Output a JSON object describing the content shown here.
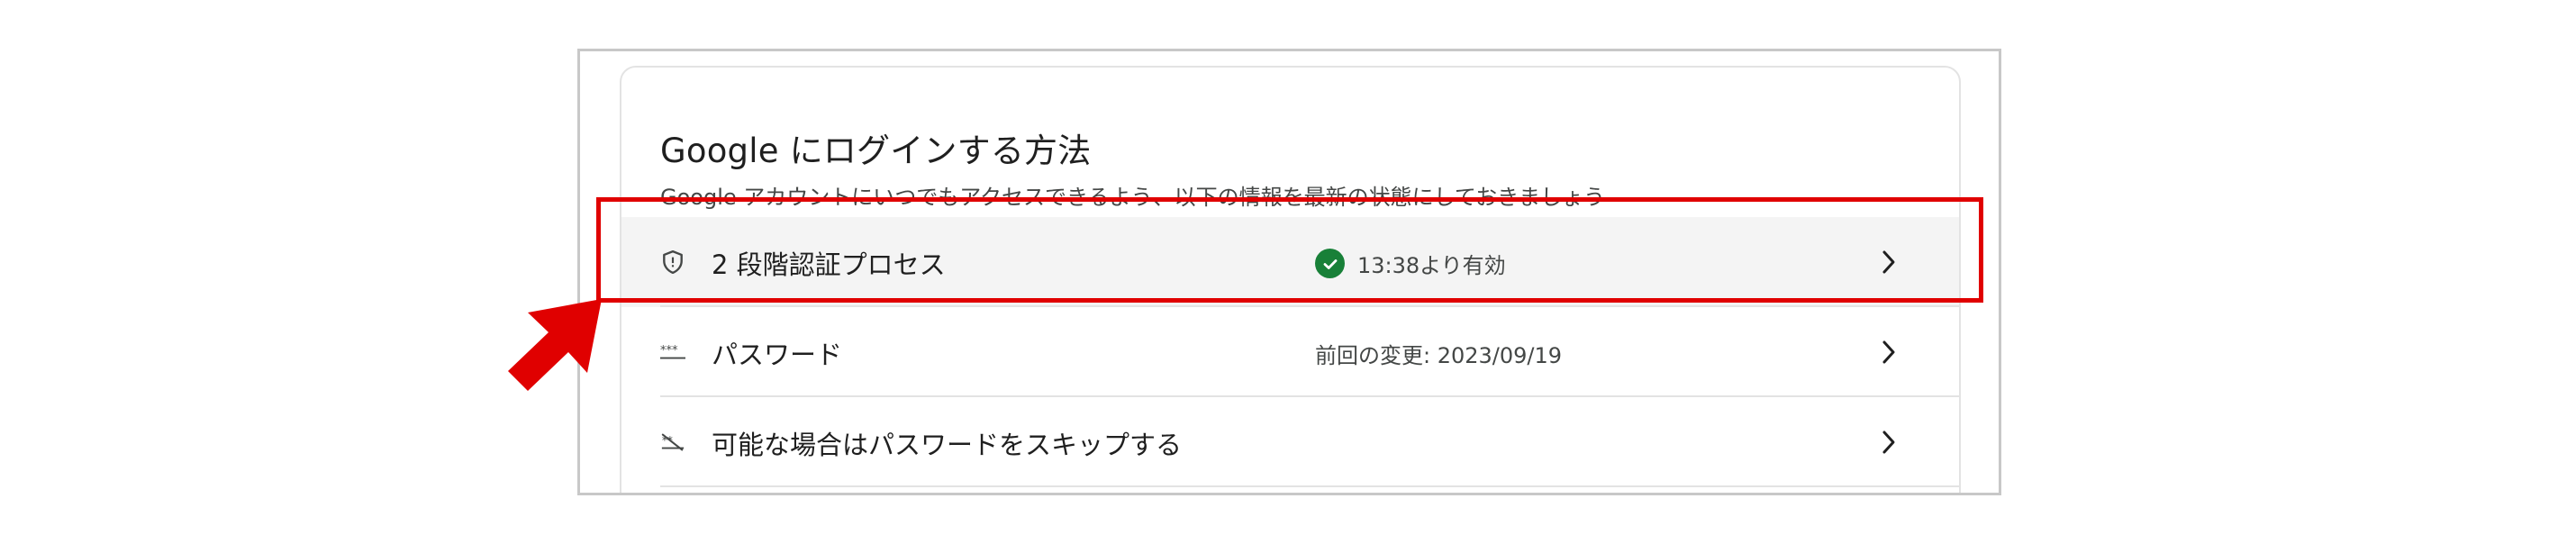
{
  "section": {
    "title": "Google にログインする方法",
    "subtitle": "Google アカウントにいつでもアクセスできるよう、以下の情報を最新の状態にしておきましょう"
  },
  "rows": [
    {
      "label": "2 段階認証プロセス",
      "status": "13:38より有効",
      "icon": "shield-icon"
    },
    {
      "label": "パスワード",
      "status": "前回の変更: 2023/09/19",
      "icon": "password-dots-icon"
    },
    {
      "label": "可能な場合はパスワードをスキップする",
      "status": "",
      "icon": "skip-password-icon"
    }
  ],
  "colors": {
    "highlight_border": "#e00000",
    "success_green": "#188038",
    "annotation_arrow": "#e00000"
  }
}
